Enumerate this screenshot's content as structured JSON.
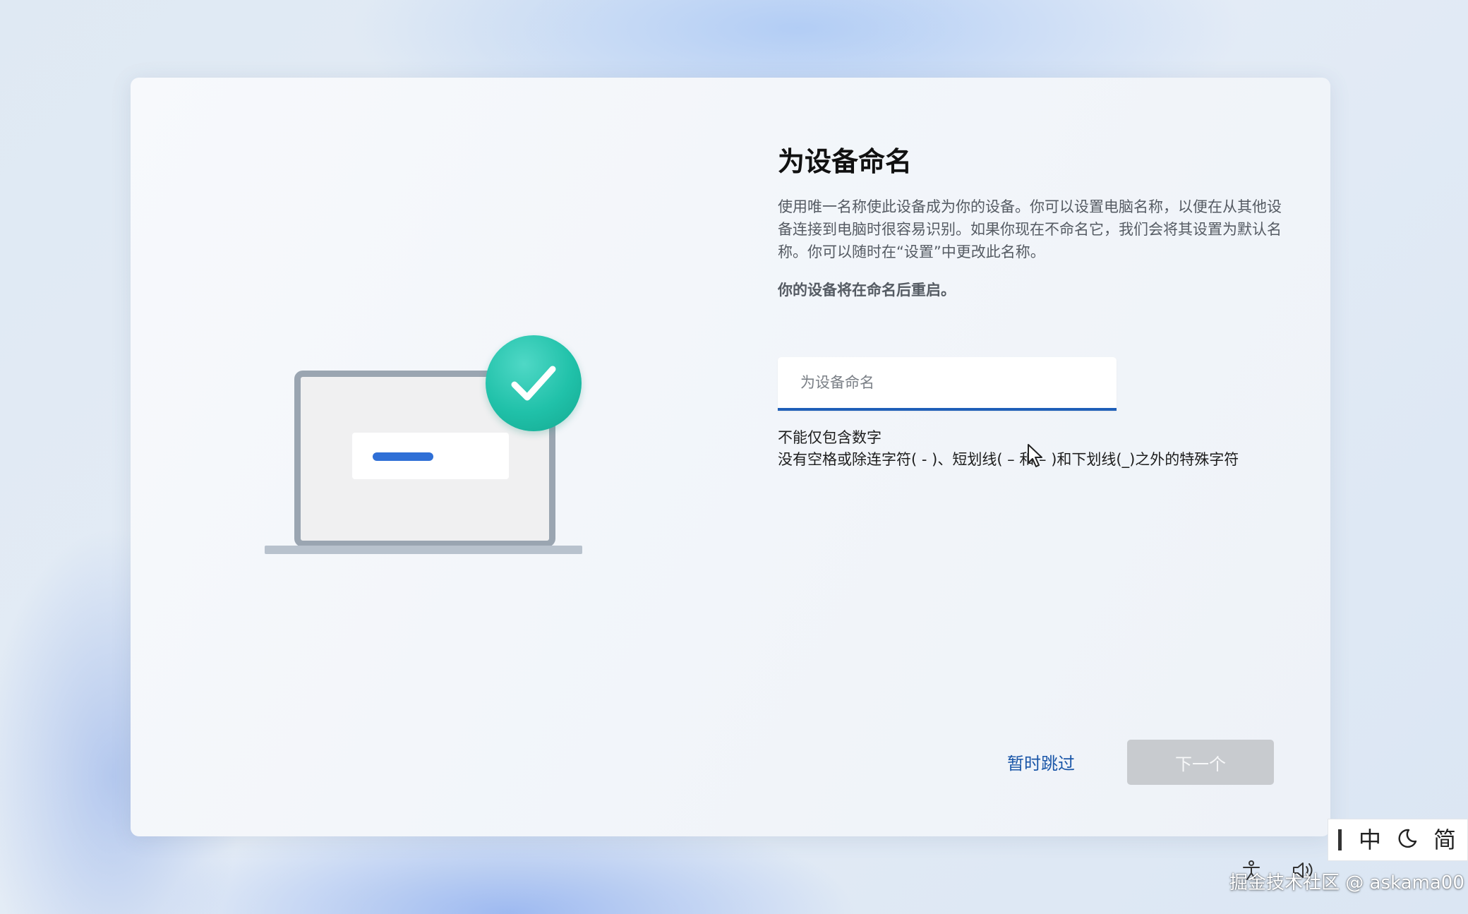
{
  "setup": {
    "title": "为设备命名",
    "description": "使用唯一名称使此设备成为你的设备。你可以设置电脑名称，以便在从其他设备连接到电脑时很容易识别。如果你现在不命名它，我们会将其设置为默认名称。你可以随时在“设置”中更改此名称。",
    "restart_note": "你的设备将在命名后重启。",
    "name_input": {
      "placeholder": "为设备命名",
      "value": ""
    },
    "rules": [
      "不能仅包含数字",
      "没有空格或除连字符( - )、短划线( – 和 – )和下划线(_)之外的特殊字符"
    ],
    "skip_label": "暂时跳过",
    "next_label": "下一个"
  },
  "ime": {
    "mode": "中",
    "charset": "简"
  },
  "watermark": "掘金技术社区 @ askama00",
  "colors": {
    "accent": "#1f5fb8",
    "link": "#1a56a8",
    "check": "#20c1a9",
    "disabled_button": "#c8cbcf"
  }
}
